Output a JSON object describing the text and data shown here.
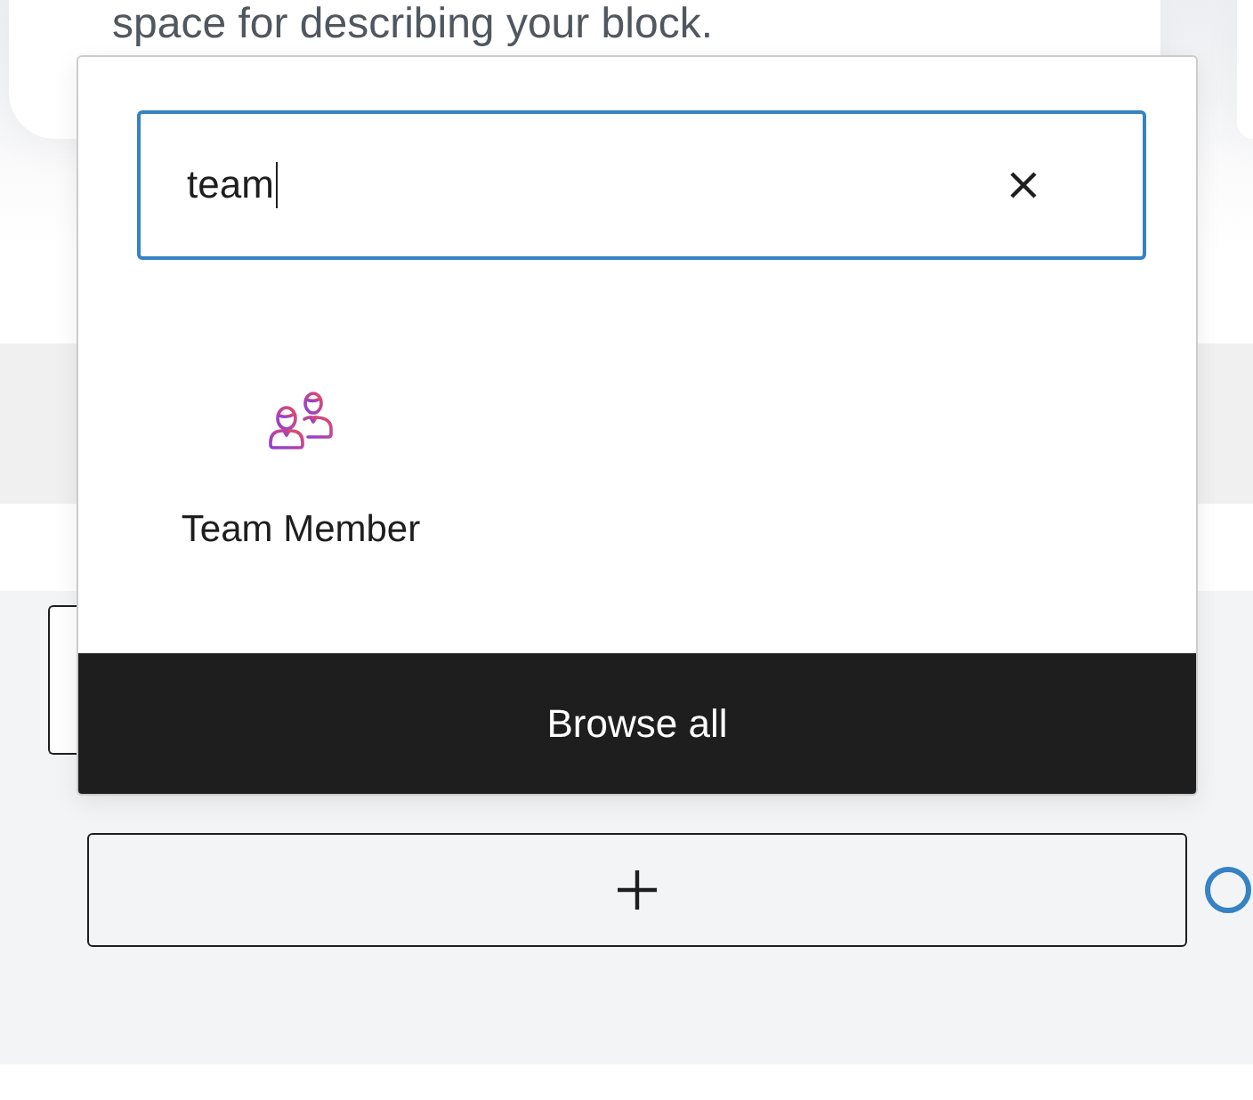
{
  "card": {
    "text": "space for describing your block."
  },
  "inserter": {
    "search": {
      "value": "team"
    },
    "results": [
      {
        "label": "Team Member"
      }
    ],
    "browse_all": {
      "label": "Browse all"
    }
  }
}
